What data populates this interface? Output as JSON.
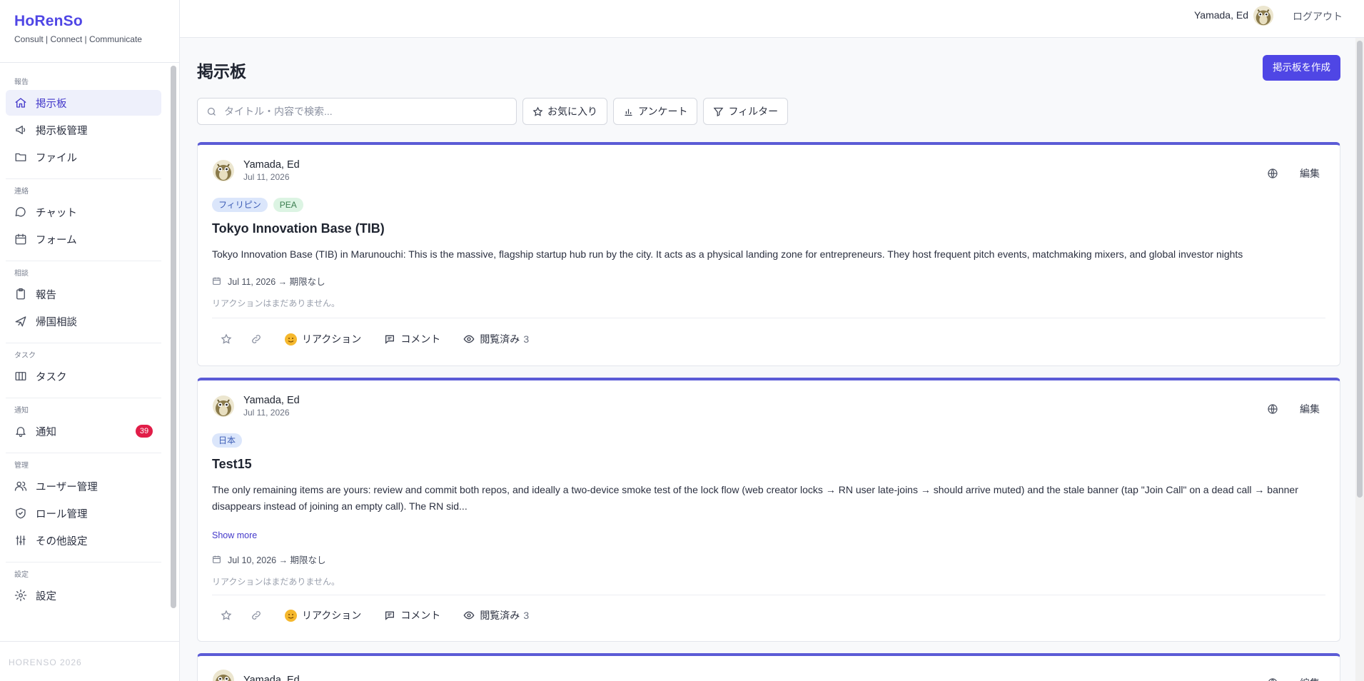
{
  "brand": {
    "title": "HoRenSo",
    "subtitle": "Consult | Connect | Communicate"
  },
  "sidebar": {
    "sections": [
      {
        "title": "報告",
        "items": [
          {
            "label": "掲示板",
            "icon": "home-icon",
            "active": true
          },
          {
            "label": "掲示板管理",
            "icon": "megaphone-icon"
          },
          {
            "label": "ファイル",
            "icon": "folder-icon"
          }
        ]
      },
      {
        "title": "連絡",
        "items": [
          {
            "label": "チャット",
            "icon": "chat-icon"
          },
          {
            "label": "フォーム",
            "icon": "calendar-icon"
          }
        ]
      },
      {
        "title": "相談",
        "items": [
          {
            "label": "報告",
            "icon": "clipboard-icon"
          },
          {
            "label": "帰国相談",
            "icon": "plane-icon"
          }
        ]
      },
      {
        "title": "タスク",
        "items": [
          {
            "label": "タスク",
            "icon": "columns-icon"
          }
        ]
      },
      {
        "title": "通知",
        "items": [
          {
            "label": "通知",
            "icon": "bell-icon",
            "badge": "39"
          }
        ]
      },
      {
        "title": "管理",
        "items": [
          {
            "label": "ユーザー管理",
            "icon": "users-icon"
          },
          {
            "label": "ロール管理",
            "icon": "shield-icon"
          },
          {
            "label": "その他設定",
            "icon": "sliders-icon"
          }
        ]
      },
      {
        "title": "設定",
        "items": [
          {
            "label": "設定",
            "icon": "gear-icon"
          }
        ]
      }
    ],
    "footer": "HORENSO 2026"
  },
  "topbar": {
    "user": "Yamada, Ed",
    "logout": "ログアウト"
  },
  "page": {
    "title": "掲示板",
    "create_label": "掲示板を作成"
  },
  "toolbar": {
    "search_placeholder": "タイトル・内容で検索...",
    "favorites": "お気に入り",
    "survey": "アンケート",
    "filter": "フィルター"
  },
  "posts": [
    {
      "author": "Yamada, Ed",
      "date": "Jul 11, 2026",
      "tags": [
        {
          "label": "フィリピン",
          "color": "blue"
        },
        {
          "label": "PEA",
          "color": "green"
        }
      ],
      "title": "Tokyo Innovation Base (TIB)",
      "body": "Tokyo Innovation Base (TIB) in Marunouchi: This is the massive, flagship startup hub run by the city. It acts as a physical landing zone for entrepreneurs. They host frequent pitch events, matchmaking mixers, and global investor nights",
      "show_more": "",
      "period": "Jul 11, 2026 → 期限なし",
      "no_reactions": "リアクションはまだありません。",
      "edit": "編集",
      "actions": {
        "reaction": "リアクション",
        "comment": "コメント",
        "viewed": "閲覧済み",
        "viewed_count": "3"
      }
    },
    {
      "author": "Yamada, Ed",
      "date": "Jul 11, 2026",
      "tags": [
        {
          "label": "日本",
          "color": "blue"
        }
      ],
      "title": "Test15",
      "body": "The only remaining items are yours: review and commit both repos, and ideally a two-device smoke test of the lock flow (web creator locks → RN user late-joins → should arrive muted) and the stale banner (tap \"Join Call\" on a dead call → banner disappears instead of joining an empty call). The RN sid...",
      "show_more": "Show more",
      "period": "Jul 10, 2026 → 期限なし",
      "no_reactions": "リアクションはまだありません。",
      "edit": "編集",
      "actions": {
        "reaction": "リアクション",
        "comment": "コメント",
        "viewed": "閲覧済み",
        "viewed_count": "3"
      }
    },
    {
      "author": "Yamada, Ed",
      "date": "",
      "tags": [],
      "title": "",
      "body": "",
      "show_more": "",
      "period": "",
      "no_reactions": "",
      "edit": "編集",
      "actions": {
        "reaction": "",
        "comment": "",
        "viewed": "",
        "viewed_count": ""
      }
    }
  ],
  "colors": {
    "accent": "#4f46e5",
    "card_top": "#5b5bd6",
    "badge": "#e11d48"
  }
}
